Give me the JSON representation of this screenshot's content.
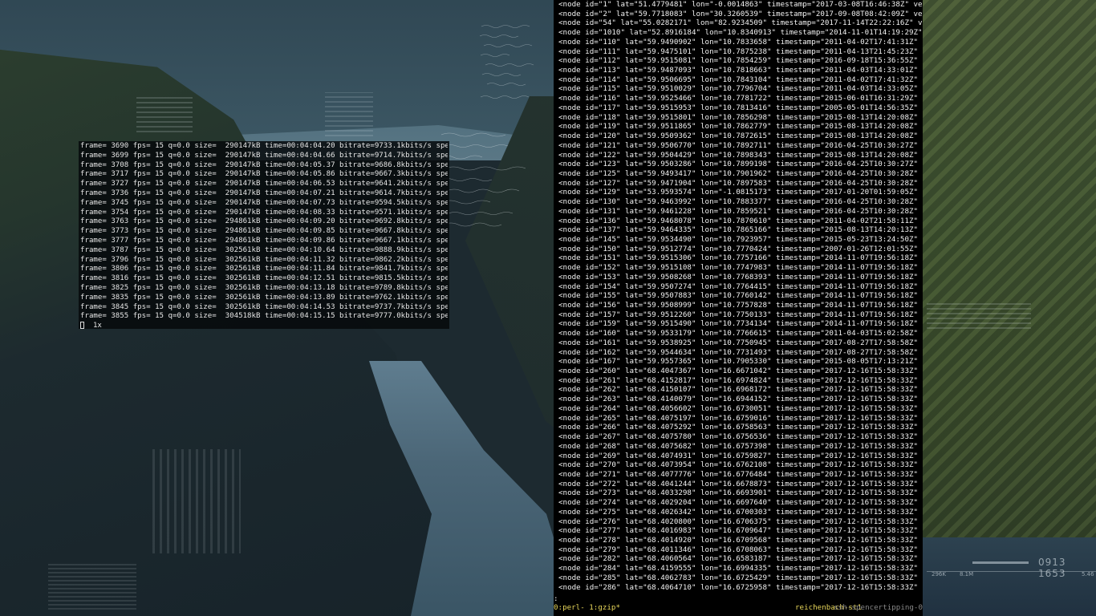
{
  "ffmpeg": {
    "lines": [
      "frame= 3690 fps= 15 q=0.0 size=  290147kB time=00:04:04.20 bitrate=9733.1kbits/s speed",
      "frame= 3699 fps= 15 q=0.0 size=  290147kB time=00:04:04.66 bitrate=9714.7kbits/s speed",
      "frame= 3708 fps= 15 q=0.0 size=  290147kB time=00:04:05.37 bitrate=9686.8kbits/s speed",
      "frame= 3717 fps= 15 q=0.0 size=  290147kB time=00:04:05.86 bitrate=9667.3kbits/s speed",
      "frame= 3727 fps= 15 q=0.0 size=  290147kB time=00:04:06.53 bitrate=9641.2kbits/s speed",
      "frame= 3736 fps= 15 q=0.0 size=  290147kB time=00:04:07.21 bitrate=9614.7kbits/s speed",
      "frame= 3745 fps= 15 q=0.0 size=  290147kB time=00:04:07.73 bitrate=9594.5kbits/s speed",
      "frame= 3754 fps= 15 q=0.0 size=  290147kB time=00:04:08.33 bitrate=9571.1kbits/s speed",
      "frame= 3763 fps= 15 q=0.0 size=  294861kB time=00:04:09.20 bitrate=9692.8kbits/s speed",
      "frame= 3773 fps= 15 q=0.0 size=  294861kB time=00:04:09.85 bitrate=9667.8kbits/s speed",
      "frame= 3777 fps= 15 q=0.0 size=  294861kB time=00:04:09.86 bitrate=9667.1kbits/s speed",
      "frame= 3787 fps= 15 q=0.0 size=  302561kB time=00:04:10.64 bitrate=9888.9kbits/s speed",
      "frame= 3796 fps= 15 q=0.0 size=  302561kB time=00:04:11.32 bitrate=9862.2kbits/s speed",
      "frame= 3806 fps= 15 q=0.0 size=  302561kB time=00:04:11.84 bitrate=9841.7kbits/s speed",
      "frame= 3816 fps= 15 q=0.0 size=  302561kB time=00:04:12.51 bitrate=9815.5kbits/s speed",
      "frame= 3825 fps= 15 q=0.0 size=  302561kB time=00:04:13.18 bitrate=9789.8kbits/s speed",
      "frame= 3835 fps= 15 q=0.0 size=  302561kB time=00:04:13.89 bitrate=9762.1kbits/s speed",
      "frame= 3845 fps= 15 q=0.0 size=  302561kB time=00:04:14.53 bitrate=9737.7kbits/s speed",
      "frame= 3855 fps= 15 q=0.0 size=  304518kB time=00:04:15.15 bitrate=9777.0kbits/s speed"
    ],
    "prompt_suffix": "  1x"
  },
  "osm": {
    "lines": [
      "<node id=\"1\" lat=\"51.4779481\" lon=\"-0.0014863\" timestamp=\"2017-03-08T16:46:38Z\" versi",
      "<node id=\"2\" lat=\"59.7718083\" lon=\"30.3260539\" timestamp=\"2017-09-08T08:42:09Z\" versi",
      "<node id=\"54\" lat=\"55.0282171\" lon=\"82.9234509\" timestamp=\"2017-11-14T22:22:16Z\" vers",
      "<node id=\"1010\" lat=\"52.8916184\" lon=\"10.8340913\" timestamp=\"2014-11-01T14:19:29Z\" ver",
      "<node id=\"110\" lat=\"59.9490902\" lon=\"10.7833658\" timestamp=\"2011-04-02T17:41:31Z\" ver",
      "<node id=\"111\" lat=\"59.9475101\" lon=\"10.7875238\" timestamp=\"2011-04-13T21:45:23Z\" ver",
      "<node id=\"112\" lat=\"59.9515081\" lon=\"10.7854259\" timestamp=\"2016-09-18T15:36:55Z\" ver",
      "<node id=\"113\" lat=\"59.9487093\" lon=\"10.7818663\" timestamp=\"2011-04-03T14:33:01Z\" ver",
      "<node id=\"114\" lat=\"59.9506695\" lon=\"10.7843104\" timestamp=\"2011-04-02T17:41:32Z\" ver",
      "<node id=\"115\" lat=\"59.9510029\" lon=\"10.7796704\" timestamp=\"2011-04-03T14:33:05Z\" ver",
      "<node id=\"116\" lat=\"59.9525466\" lon=\"10.7781722\" timestamp=\"2015-06-01T16:31:29Z\" ver",
      "<node id=\"117\" lat=\"59.9515953\" lon=\"10.7813416\" timestamp=\"2005-05-01T14:56:35Z\" ver",
      "<node id=\"118\" lat=\"59.9515801\" lon=\"10.7856298\" timestamp=\"2015-08-13T14:20:08Z\" ver",
      "<node id=\"119\" lat=\"59.9511865\" lon=\"10.7862779\" timestamp=\"2015-08-13T14:20:08Z\" ver",
      "<node id=\"120\" lat=\"59.9509362\" lon=\"10.7872615\" timestamp=\"2015-08-13T14:20:08Z\" ver",
      "<node id=\"121\" lat=\"59.9506770\" lon=\"10.7892711\" timestamp=\"2016-04-25T10:30:27Z\" ver",
      "<node id=\"122\" lat=\"59.9504429\" lon=\"10.7898343\" timestamp=\"2015-08-13T14:20:08Z\" ver",
      "<node id=\"123\" lat=\"59.9503286\" lon=\"10.7899198\" timestamp=\"2016-04-25T10:30:27Z\" ver",
      "<node id=\"125\" lat=\"59.9493417\" lon=\"10.7901962\" timestamp=\"2016-04-25T10:30:28Z\" ver",
      "<node id=\"127\" lat=\"59.9471904\" lon=\"10.7897583\" timestamp=\"2016-04-25T10:30:28Z\" ver",
      "<node id=\"129\" lat=\"53.9593574\" lon=\"-1.0815173\" timestamp=\"2017-01-20T01:59:05Z\" ver",
      "<node id=\"130\" lat=\"59.9463992\" lon=\"10.7883377\" timestamp=\"2016-04-25T10:30:28Z\" ver",
      "<node id=\"131\" lat=\"59.9461228\" lon=\"10.7859521\" timestamp=\"2016-04-25T10:30:28Z\" ver",
      "<node id=\"136\" lat=\"59.9468078\" lon=\"10.7870610\" timestamp=\"2011-04-02T21:58:11Z\" ver",
      "<node id=\"137\" lat=\"59.9464335\" lon=\"10.7865166\" timestamp=\"2015-08-13T14:20:13Z\" ver",
      "<node id=\"145\" lat=\"59.9534490\" lon=\"10.7923957\" timestamp=\"2015-05-23T13:24:50Z\" ver",
      "<node id=\"150\" lat=\"59.9512774\" lon=\"10.7770424\" timestamp=\"2007-01-26T12:01:55Z\" ver",
      "<node id=\"151\" lat=\"59.9515306\" lon=\"10.7757166\" timestamp=\"2014-11-07T19:56:18Z\" ver",
      "<node id=\"152\" lat=\"59.9515108\" lon=\"10.7747983\" timestamp=\"2014-11-07T19:56:18Z\" ver",
      "<node id=\"153\" lat=\"59.9508268\" lon=\"10.7768393\" timestamp=\"2014-11-07T19:56:18Z\" ver",
      "<node id=\"154\" lat=\"59.9507274\" lon=\"10.7764415\" timestamp=\"2014-11-07T19:56:18Z\" ver",
      "<node id=\"155\" lat=\"59.9507883\" lon=\"10.7760142\" timestamp=\"2014-11-07T19:56:18Z\" ver",
      "<node id=\"156\" lat=\"59.9508999\" lon=\"10.7757828\" timestamp=\"2014-11-07T19:56:18Z\" ver",
      "<node id=\"157\" lat=\"59.9512260\" lon=\"10.7750133\" timestamp=\"2014-11-07T19:56:18Z\" ver",
      "<node id=\"159\" lat=\"59.9515490\" lon=\"10.7734134\" timestamp=\"2014-11-07T19:56:18Z\" ver",
      "<node id=\"160\" lat=\"59.9533179\" lon=\"10.7766615\" timestamp=\"2011-04-03T15:02:58Z\" ver",
      "<node id=\"161\" lat=\"59.9538925\" lon=\"10.7750945\" timestamp=\"2017-08-27T17:58:58Z\" ver",
      "<node id=\"162\" lat=\"59.9544634\" lon=\"10.7731493\" timestamp=\"2017-08-27T17:58:58Z\" ver",
      "<node id=\"167\" lat=\"59.9557365\" lon=\"10.7905330\" timestamp=\"2015-08-05T17:13:21Z\" ver",
      "<node id=\"260\" lat=\"68.4047367\" lon=\"16.6671042\" timestamp=\"2017-12-16T15:58:33Z\" ver",
      "<node id=\"261\" lat=\"68.4152817\" lon=\"16.6974824\" timestamp=\"2017-12-16T15:58:33Z\" ver",
      "<node id=\"262\" lat=\"68.4150107\" lon=\"16.6968172\" timestamp=\"2017-12-16T15:58:33Z\" ver",
      "<node id=\"263\" lat=\"68.4140079\" lon=\"16.6944152\" timestamp=\"2017-12-16T15:58:33Z\" ver",
      "<node id=\"264\" lat=\"68.4056602\" lon=\"16.6730051\" timestamp=\"2017-12-16T15:58:33Z\" ver",
      "<node id=\"265\" lat=\"68.4075197\" lon=\"16.6759016\" timestamp=\"2017-12-16T15:58:33Z\" ver",
      "<node id=\"266\" lat=\"68.4075292\" lon=\"16.6758563\" timestamp=\"2017-12-16T15:58:33Z\" ver",
      "<node id=\"267\" lat=\"68.4075780\" lon=\"16.6756536\" timestamp=\"2017-12-16T15:58:33Z\" ver",
      "<node id=\"268\" lat=\"68.4075682\" lon=\"16.6757398\" timestamp=\"2017-12-16T15:58:33Z\" ver",
      "<node id=\"269\" lat=\"68.4074931\" lon=\"16.6759827\" timestamp=\"2017-12-16T15:58:33Z\" ver",
      "<node id=\"270\" lat=\"68.4073954\" lon=\"16.6762108\" timestamp=\"2017-12-16T15:58:33Z\" ver",
      "<node id=\"271\" lat=\"68.4077776\" lon=\"16.6776484\" timestamp=\"2017-12-16T15:58:33Z\" ver",
      "<node id=\"272\" lat=\"68.4041244\" lon=\"16.6678873\" timestamp=\"2017-12-16T15:58:33Z\" ver",
      "<node id=\"273\" lat=\"68.4033298\" lon=\"16.6693901\" timestamp=\"2017-12-16T15:58:33Z\" ver",
      "<node id=\"274\" lat=\"68.4029204\" lon=\"16.6697640\" timestamp=\"2017-12-16T15:58:33Z\" ver",
      "<node id=\"275\" lat=\"68.4026342\" lon=\"16.6700303\" timestamp=\"2017-12-16T15:58:33Z\" ver",
      "<node id=\"276\" lat=\"68.4020800\" lon=\"16.6706375\" timestamp=\"2017-12-16T15:58:33Z\" ver",
      "<node id=\"277\" lat=\"68.4016983\" lon=\"16.6709647\" timestamp=\"2017-12-16T15:58:33Z\" ver",
      "<node id=\"278\" lat=\"68.4014920\" lon=\"16.6709568\" timestamp=\"2017-12-16T15:58:33Z\" ver",
      "<node id=\"279\" lat=\"68.4011346\" lon=\"16.6708063\" timestamp=\"2017-12-16T15:58:33Z\" ver",
      "<node id=\"282\" lat=\"68.4060564\" lon=\"16.6583187\" timestamp=\"2017-12-16T15:58:33Z\" ver",
      "<node id=\"284\" lat=\"68.4159555\" lon=\"16.6994335\" timestamp=\"2017-12-16T15:58:33Z\" ver",
      "<node id=\"285\" lat=\"68.4062783\" lon=\"16.6725429\" timestamp=\"2017-12-16T15:58:33Z\" ver",
      "<node id=\"286\" lat=\"68.4064710\" lon=\"16.6725958\" timestamp=\"2017-12-16T15:58:33Z\" ver"
    ],
    "pager_prompt": ":"
  },
  "tmux": {
    "windows": "0:perl- 1:gzip*",
    "host": "reichenbach-st1",
    "session": "ssh-spencertipping-0"
  },
  "wallpaper": {
    "hud_counter": "0913 1653",
    "hud_mem": "296K",
    "hud_val": "8.1M",
    "hud_right": "5.46"
  }
}
